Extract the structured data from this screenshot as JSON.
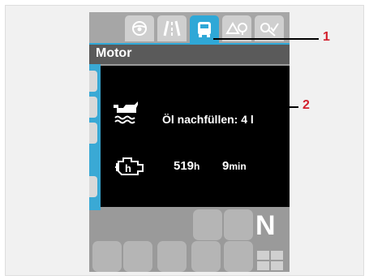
{
  "tabs": [
    {
      "icon": "steering-wheel-icon"
    },
    {
      "icon": "road-icon"
    },
    {
      "icon": "vehicle-icon",
      "active": true
    },
    {
      "icon": "road-sign-icon"
    },
    {
      "icon": "service-icon"
    }
  ],
  "header": {
    "title": "Motor"
  },
  "oil": {
    "icon": "oil-can-icon",
    "message": "Öl nachfüllen: 4 l"
  },
  "engine": {
    "icon": "engine-icon",
    "hours_value": "519",
    "hours_unit": "h",
    "minutes_value": "9",
    "minutes_unit": "min"
  },
  "gear": {
    "indicator": "N"
  },
  "callouts": {
    "one": "1",
    "two": "2"
  },
  "colors": {
    "accent": "#2fa8d7",
    "callout": "#d3202d"
  }
}
